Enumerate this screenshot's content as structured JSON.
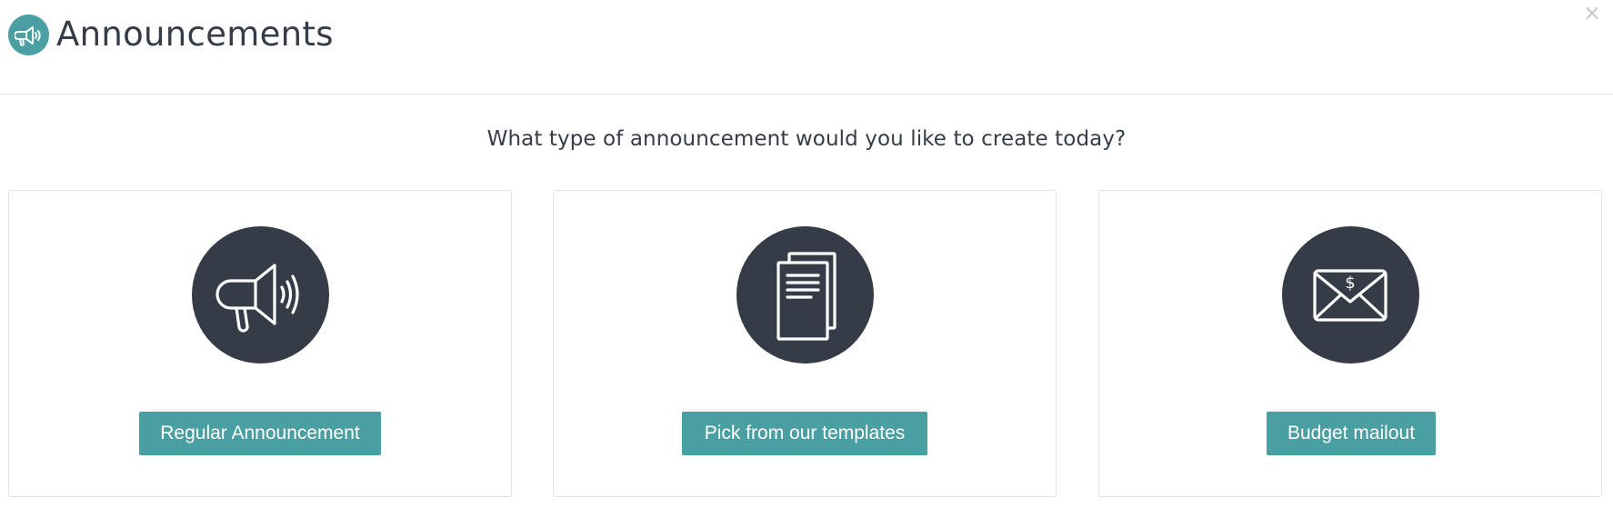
{
  "dialog": {
    "title": "Announcements",
    "close_label": "×",
    "header_icon": "megaphone-icon"
  },
  "prompt": "What type of announcement would you like to create today?",
  "cards": [
    {
      "icon": "megaphone-icon",
      "button_label": "Regular Announcement"
    },
    {
      "icon": "documents-icon",
      "button_label": "Pick from our templates"
    },
    {
      "icon": "envelope-dollar-icon",
      "button_label": "Budget mailout"
    }
  ],
  "colors": {
    "accent": "#4a9fa3",
    "icon_circle": "#363c47",
    "text": "#363c47"
  }
}
